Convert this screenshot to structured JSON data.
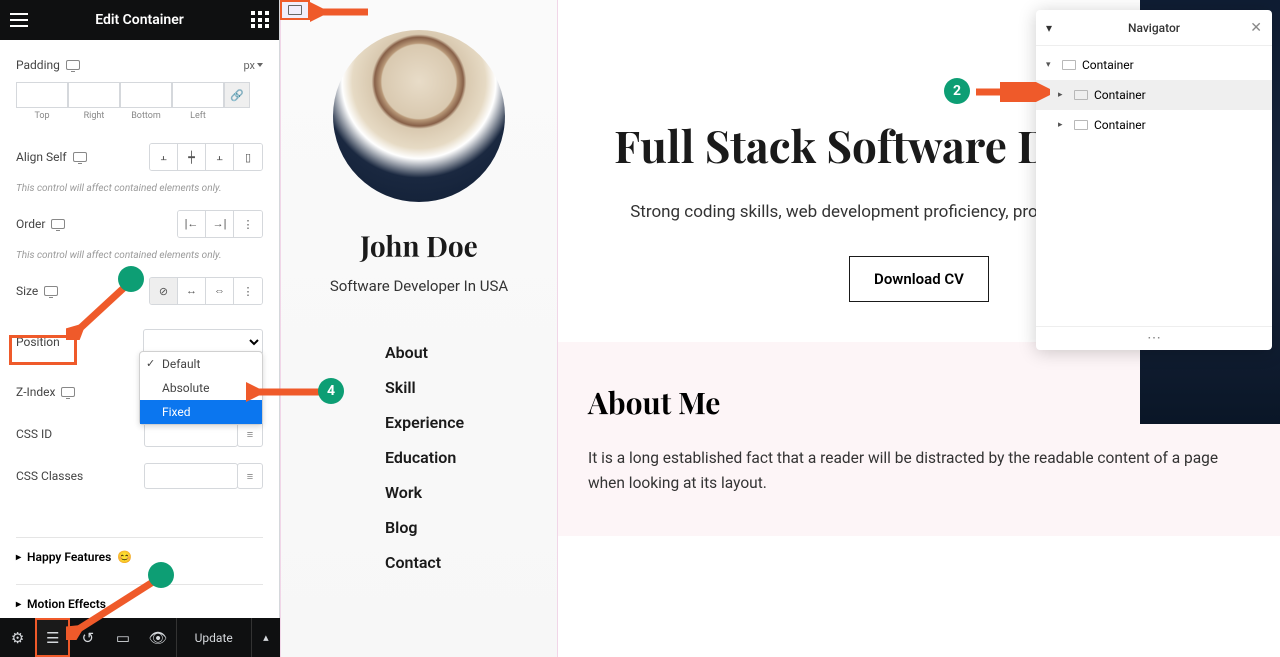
{
  "panel": {
    "title": "Edit Container",
    "padding_label": "Padding",
    "padding_unit": "px",
    "sides": [
      "Top",
      "Right",
      "Bottom",
      "Left"
    ],
    "align_self_label": "Align Self",
    "note_contained": "This control will affect contained elements only.",
    "order_label": "Order",
    "size_label": "Size",
    "position_label": "Position",
    "zindex_label": "Z-Index",
    "cssid_label": "CSS ID",
    "cssclasses_label": "CSS Classes",
    "accordion_happy": "Happy Features",
    "accordion_motion": "Motion Effects",
    "position_options": {
      "default": "Default",
      "absolute": "Absolute",
      "fixed": "Fixed"
    }
  },
  "footer": {
    "update": "Update"
  },
  "profile": {
    "name": "John Doe",
    "role": "Software Developer In USA",
    "menu": [
      "About",
      "Skill",
      "Experience",
      "Education",
      "Work",
      "Blog",
      "Contact"
    ]
  },
  "hero": {
    "title": "Full Stack Software Developer",
    "subtitle": "Strong coding skills, web development proficiency, problem-solving expertise",
    "button": "Download CV"
  },
  "about": {
    "title": "About Me",
    "text": "It is a long established fact that a reader will be distracted by the readable content of a page when looking at its layout."
  },
  "navigator": {
    "title": "Navigator",
    "items": [
      "Container",
      "Container",
      "Container"
    ]
  },
  "badges": {
    "b2": "2",
    "b4": "4"
  }
}
